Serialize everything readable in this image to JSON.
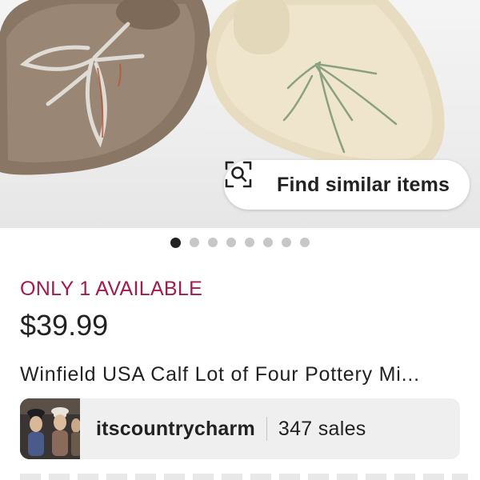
{
  "product_image": {
    "find_similar_label": "Find similar items",
    "icon": "visual-search-icon",
    "carousel_dots": 8,
    "active_dot": 0
  },
  "listing": {
    "availability": "ONLY 1 AVAILABLE",
    "price": "$39.99",
    "title": "Winfield USA Calf Lot of Four Pottery Mi..."
  },
  "shop": {
    "name": "itscountrycharm",
    "sales": "347 sales",
    "avatar_icon": "shop-avatar"
  },
  "colors": {
    "availability": "#a61a4b",
    "text": "#222222",
    "card_bg": "#efefef",
    "dot_inactive": "#c7c7c7",
    "dot_active": "#222222"
  }
}
